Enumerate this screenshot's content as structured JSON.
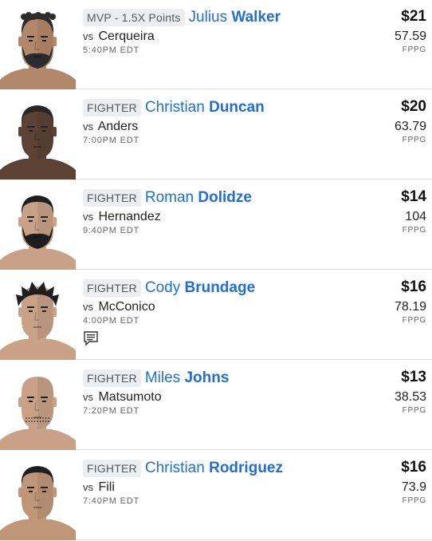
{
  "fighters": [
    {
      "position": "MVP - 1.5X Points",
      "first": "Julius",
      "last": "Walker",
      "opponent": "Cerqueira",
      "vs": "vs",
      "time": "5:40PM EDT",
      "salary": "$21",
      "fppg": "57.59",
      "fppg_label": "FPPG",
      "skin": "#b3876a",
      "hair": "#2c2c2c",
      "beard": true,
      "style": "curly",
      "notes": false
    },
    {
      "position": "FIGHTER",
      "first": "Christian",
      "last": "Duncan",
      "opponent": "Anders",
      "vs": "vs",
      "time": "7:00PM EDT",
      "salary": "$20",
      "fppg": "63.79",
      "fppg_label": "FPPG",
      "skin": "#5b4235",
      "hair": "#2b2420",
      "beard": false,
      "style": "short",
      "notes": false
    },
    {
      "position": "FIGHTER",
      "first": "Roman",
      "last": "Dolidze",
      "opponent": "Hernandez",
      "vs": "vs",
      "time": "9:40PM EDT",
      "salary": "$14",
      "fppg": "104",
      "fppg_label": "FPPG",
      "skin": "#c9a187",
      "hair": "#1e1e1e",
      "beard": true,
      "style": "short",
      "notes": false
    },
    {
      "position": "FIGHTER",
      "first": "Cody",
      "last": "Brundage",
      "opponent": "McConico",
      "vs": "vs",
      "time": "4:00PM EDT",
      "salary": "$16",
      "fppg": "78.19",
      "fppg_label": "FPPG",
      "skin": "#c9a187",
      "hair": "#1e1e1e",
      "beard": false,
      "style": "spiky",
      "notes": true
    },
    {
      "position": "FIGHTER",
      "first": "Miles",
      "last": "Johns",
      "opponent": "Matsumoto",
      "vs": "vs",
      "time": "7:20PM EDT",
      "salary": "$13",
      "fppg": "38.53",
      "fppg_label": "FPPG",
      "skin": "#c9a187",
      "hair": "#c9a187",
      "beard": "stubble",
      "style": "bald",
      "notes": false
    },
    {
      "position": "FIGHTER",
      "first": "Christian",
      "last": "Rodriguez",
      "opponent": "Fili",
      "vs": "vs",
      "time": "7:40PM EDT",
      "salary": "$16",
      "fppg": "73.9",
      "fppg_label": "FPPG",
      "skin": "#bf9678",
      "hair": "#1e1e1e",
      "beard": false,
      "style": "short",
      "notes": false
    }
  ],
  "colors": {
    "accent": "#1f6fd6",
    "badge_bg": "#eceef1",
    "divider": "#dcdcdc"
  },
  "icons": {
    "notes": "notes-icon"
  }
}
